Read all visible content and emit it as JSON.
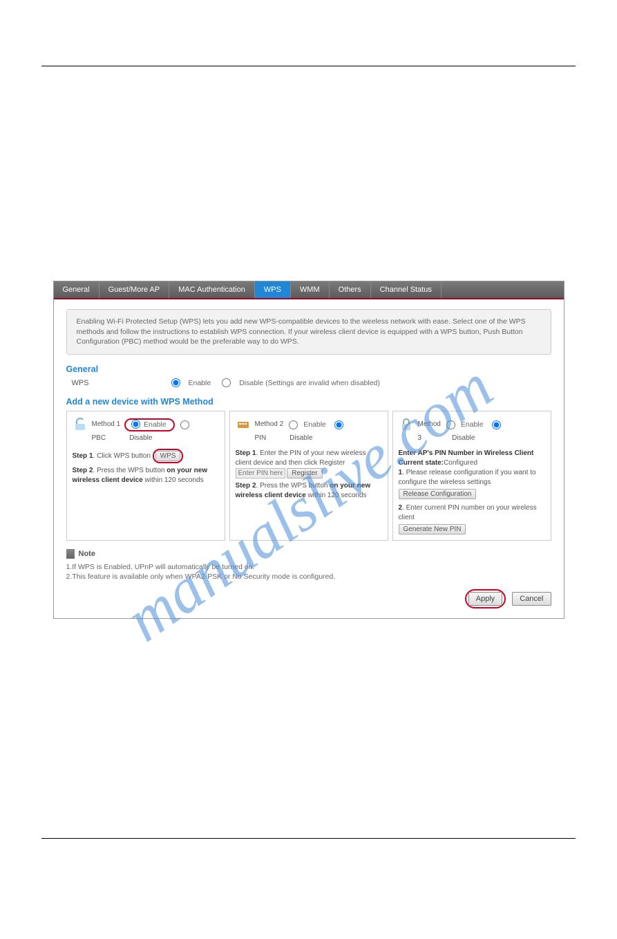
{
  "watermark": "manualslive.com",
  "tabs": {
    "items": [
      "General",
      "Guest/More AP",
      "MAC Authentication",
      "WPS",
      "WMM",
      "Others",
      "Channel Status"
    ],
    "active": "WPS"
  },
  "intro": "Enabling Wi-Fi Protected Setup (WPS) lets you add new WPS-compatible devices to the wireless network with ease. Select one of the WPS methods and follow the instructions to establish WPS connection. If your wireless client device is equipped with a WPS button, Push Button Configuration (PBC) method would be the preferable way to do WPS.",
  "general": {
    "title": "General",
    "label": "WPS",
    "enable": "Enable",
    "disable": "Disable (Settings are invalid when disabled)"
  },
  "addDevice": {
    "title": "Add a new device with WPS Method",
    "m1": {
      "title": "Method 1",
      "enable": "Enable",
      "sub": "PBC",
      "disable": "Disable",
      "s1a": "Step 1",
      "s1b": ". Click WPS button",
      "wps_btn": "WPS",
      "s2a": "Step 2",
      "s2b": ". Press the WPS button ",
      "s2c": "on your new wireless client device",
      "s2d": " within 120 seconds"
    },
    "m2": {
      "title": "Method 2",
      "enable": "Enable",
      "sub": "PIN",
      "disable": "Disable",
      "s1a": "Step 1",
      "s1b": ". Enter the PIN of your new wireless client device and then click Register",
      "pin_ph": "Enter PIN here",
      "reg_btn": "Register",
      "s2a": "Step 2",
      "s2b": ". Press the WPS button ",
      "s2c": "on your new wireless client device",
      "s2d": " within 120 seconds"
    },
    "m3": {
      "title": "Method",
      "num": "3",
      "enable": "Enable",
      "disable": "Disable",
      "head": "Enter AP's PIN Number in Wireless Client",
      "cs_l": "Current state:",
      "cs_v": "Configured",
      "n1a": "1",
      "n1b": ". Please release configuration if you want to configure the wireless settings",
      "rel_btn": "Release Configuration",
      "n2a": "2",
      "n2b": ". Enter current PIN number on your wireless client",
      "gen_btn": "Generate New PIN"
    }
  },
  "note": {
    "label": "Note",
    "l1": "1.If WPS is Enabled, UPnP will automatically be turned on.",
    "l2": "2.This feature is available only when WPA2-PSK or No Security mode is configured."
  },
  "buttons": {
    "apply": "Apply",
    "cancel": "Cancel"
  }
}
